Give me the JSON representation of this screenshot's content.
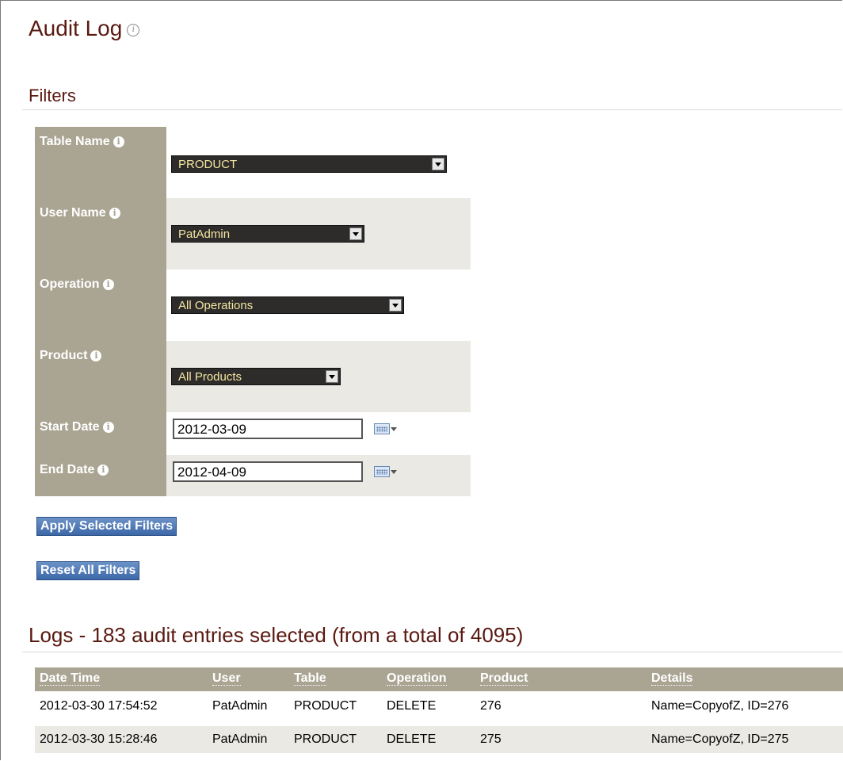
{
  "page": {
    "title": "Audit Log",
    "title_info_icon": "info-outline-icon"
  },
  "filters": {
    "heading": "Filters",
    "table_name": {
      "label": "Table Name",
      "value": "PRODUCT"
    },
    "user_name": {
      "label": "User Name",
      "value": "PatAdmin"
    },
    "operation": {
      "label": "Operation",
      "value": "All Operations"
    },
    "product": {
      "label": "Product",
      "value": "All Products"
    },
    "start_date": {
      "label": "Start Date",
      "value": "2012-03-09"
    },
    "end_date": {
      "label": "End Date",
      "value": "2012-04-09"
    },
    "info_icon": "info-icon",
    "calendar_icon": "calendar-icon"
  },
  "buttons": {
    "apply": "Apply Selected Filters",
    "reset": "Reset All Filters"
  },
  "logs": {
    "heading": "Logs - 183 audit entries selected (from a total of 4095)",
    "columns": [
      "Date Time",
      "User",
      "Table",
      "Operation",
      "Product",
      "Details"
    ],
    "rows": [
      [
        "2012-03-30 17:54:52",
        "PatAdmin",
        "PRODUCT",
        "DELETE",
        "276",
        "Name=CopyofZ, ID=276"
      ],
      [
        "2012-03-30 15:28:46",
        "PatAdmin",
        "PRODUCT",
        "DELETE",
        "275",
        "Name=CopyofZ, ID=275"
      ]
    ]
  },
  "colors": {
    "title": "#5a1a12",
    "label_bg": "#aaa593",
    "alt_row_bg": "#ebe9e4",
    "dropdown_bg": "#2d2c2b",
    "dropdown_text": "#f4e6a0",
    "button_bg": "#3d68a8"
  }
}
